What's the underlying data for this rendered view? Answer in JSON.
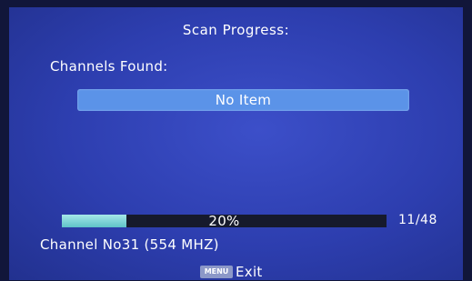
{
  "title": "Scan Progress:",
  "channels_found_label": "Channels Found:",
  "channel_list": {
    "empty_text": "No Item"
  },
  "progress": {
    "percent": 20,
    "percent_text": "20%",
    "count_text": "11/48",
    "fill_color": "#7fd6d8"
  },
  "channel_info": "Channel No31 (554 MHZ)",
  "footer": {
    "key_label": "MENU",
    "action_label": "Exit"
  },
  "colors": {
    "background": "#2d3eaf",
    "highlight_bar": "#5b93e8",
    "track": "#161a2c"
  }
}
